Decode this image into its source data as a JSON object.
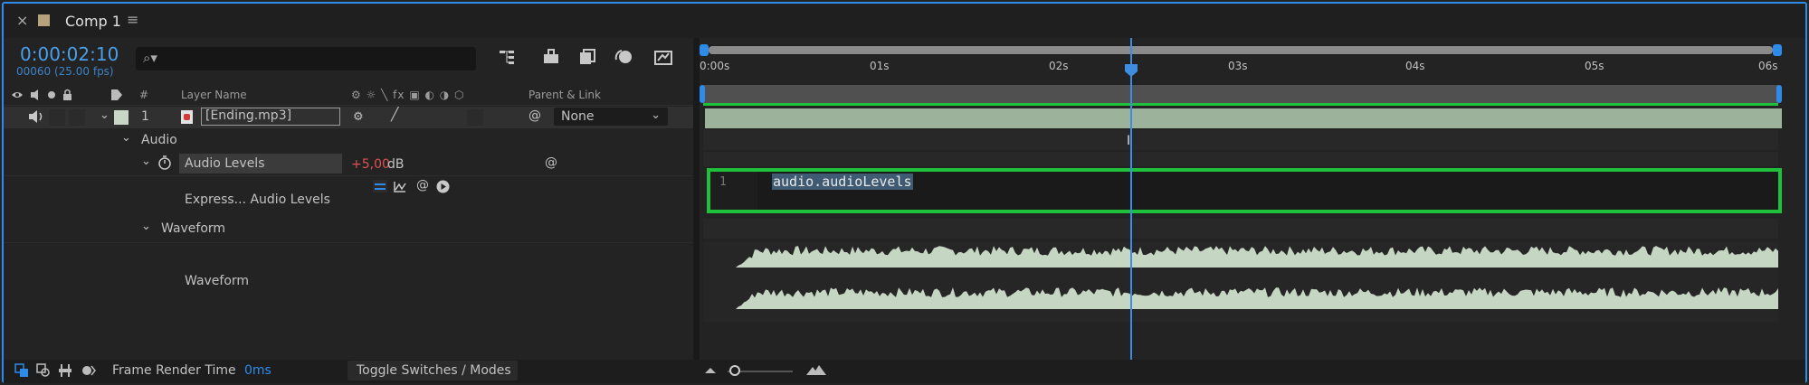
{
  "window": {
    "close_glyph": "×",
    "comp_title": "Comp 1",
    "menu_glyph": "≡",
    "swatch_color": "#b6a37e"
  },
  "header": {
    "timecode": "0:00:02:10",
    "frame_info": "00060 (25.00 fps)",
    "search_glyph": "⌕▾",
    "search_value": ""
  },
  "columns": {
    "hash": "#",
    "layer_name": "Layer Name",
    "parent_link": "Parent & Link",
    "switch_glyphs": "⚙ ☼ ╲ fx ▣ ◐ ◑ ⬡"
  },
  "layer": {
    "index": "1",
    "name": "[Ending.mp3]",
    "parent": "None",
    "label_color": "#c9d8c6"
  },
  "properties": {
    "audio_group": "Audio",
    "audio_levels_label": "Audio Levels",
    "audio_levels_value": "+5,00",
    "audio_levels_unit": "dB",
    "expression_label": "Express... Audio Levels",
    "waveform_group": "Waveform",
    "waveform_label": "Waveform"
  },
  "expression": {
    "line_number": "1",
    "code": "audio.audioLevels"
  },
  "timeline": {
    "ticks": [
      "0:00s",
      "01s",
      "02s",
      "03s",
      "04s",
      "05s",
      "06s"
    ],
    "playhead_seconds": 2.4
  },
  "statusbar": {
    "frame_render_label": "Frame Render Time",
    "frame_render_value": "0ms",
    "toggle_label": "Toggle Switches / Modes"
  },
  "colors": {
    "accent": "#2d8ceb",
    "highlight": "#1fc13b",
    "waveform": "#c5d6c2",
    "value_red": "#e05050"
  }
}
